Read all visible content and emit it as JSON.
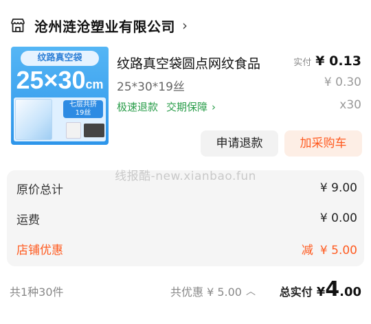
{
  "shop": {
    "name": "沧州涟沧塑业有限公司",
    "icon": "shop-icon",
    "chevron": "›"
  },
  "product": {
    "image_labels": {
      "top": "纹路真空袋",
      "size": "25×30",
      "unit": "cm",
      "layer": "七层共挤",
      "layer_sub": "19丝"
    },
    "title": "纹路真空袋圆点网纹食品",
    "spec": "25*30*19丝",
    "services": [
      "极速退款",
      "交期保障"
    ],
    "services_chevron": "›",
    "pay_label": "实付",
    "pay_price": "¥ 0.13",
    "original_price": "¥ 0.30",
    "quantity": "x30"
  },
  "actions": {
    "refund": "申请退款",
    "add_to_cart": "加采购车"
  },
  "watermark": "线报酷-new.xianbao.fun",
  "summary": {
    "rows": [
      {
        "label": "原价总计",
        "value": "¥ 9.00"
      },
      {
        "label": "运费",
        "value": "¥ 0.00"
      },
      {
        "label": "店铺优惠",
        "prefix": "减",
        "value": "¥ 5.00"
      }
    ]
  },
  "footer": {
    "count": "共1种30件",
    "total_discount": "共优惠 ¥ 5.00",
    "total_discount_chevron": "︿",
    "total_label": "总实付",
    "total_currency": "¥",
    "total_int": "4",
    "total_dec": ".00"
  },
  "colors": {
    "accent_orange": "#ff5a1f",
    "service_green": "#2a9d4a",
    "summary_bg": "#f5f5f5"
  }
}
